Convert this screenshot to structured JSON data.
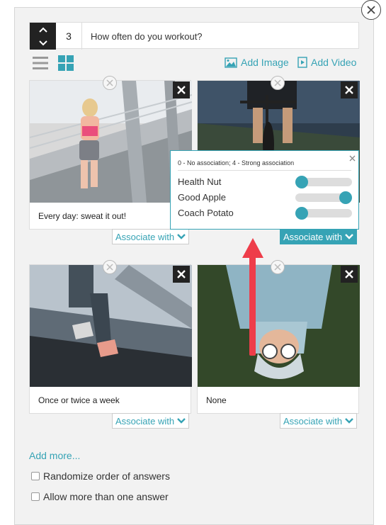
{
  "question": {
    "number": "3",
    "text": "How often do you workout?"
  },
  "toolbar": {
    "add_image": "Add Image",
    "add_video": "Add Video"
  },
  "answers": [
    {
      "caption": "Every day: sweat it out!",
      "associate_label": "Associate with"
    },
    {
      "caption": "",
      "associate_label": "Associate with"
    },
    {
      "caption": "Once or twice a week",
      "associate_label": "Associate with"
    },
    {
      "caption": "None",
      "associate_label": "Associate with"
    }
  ],
  "association_popup": {
    "hint": "0 - No association; 4 - Strong association",
    "sliders": [
      {
        "label": "Health Nut",
        "level": 0,
        "max": 4
      },
      {
        "label": "Good Apple",
        "level": 4,
        "max": 4
      },
      {
        "label": "Coach Potato",
        "level": 0,
        "max": 4
      }
    ]
  },
  "footer": {
    "add_more": "Add more...",
    "randomize_label": "Randomize order of answers",
    "multi_label": "Allow more than one answer"
  },
  "colors": {
    "accent": "#36a3b5",
    "dark": "#222222",
    "arrow": "#ee3d4a"
  }
}
